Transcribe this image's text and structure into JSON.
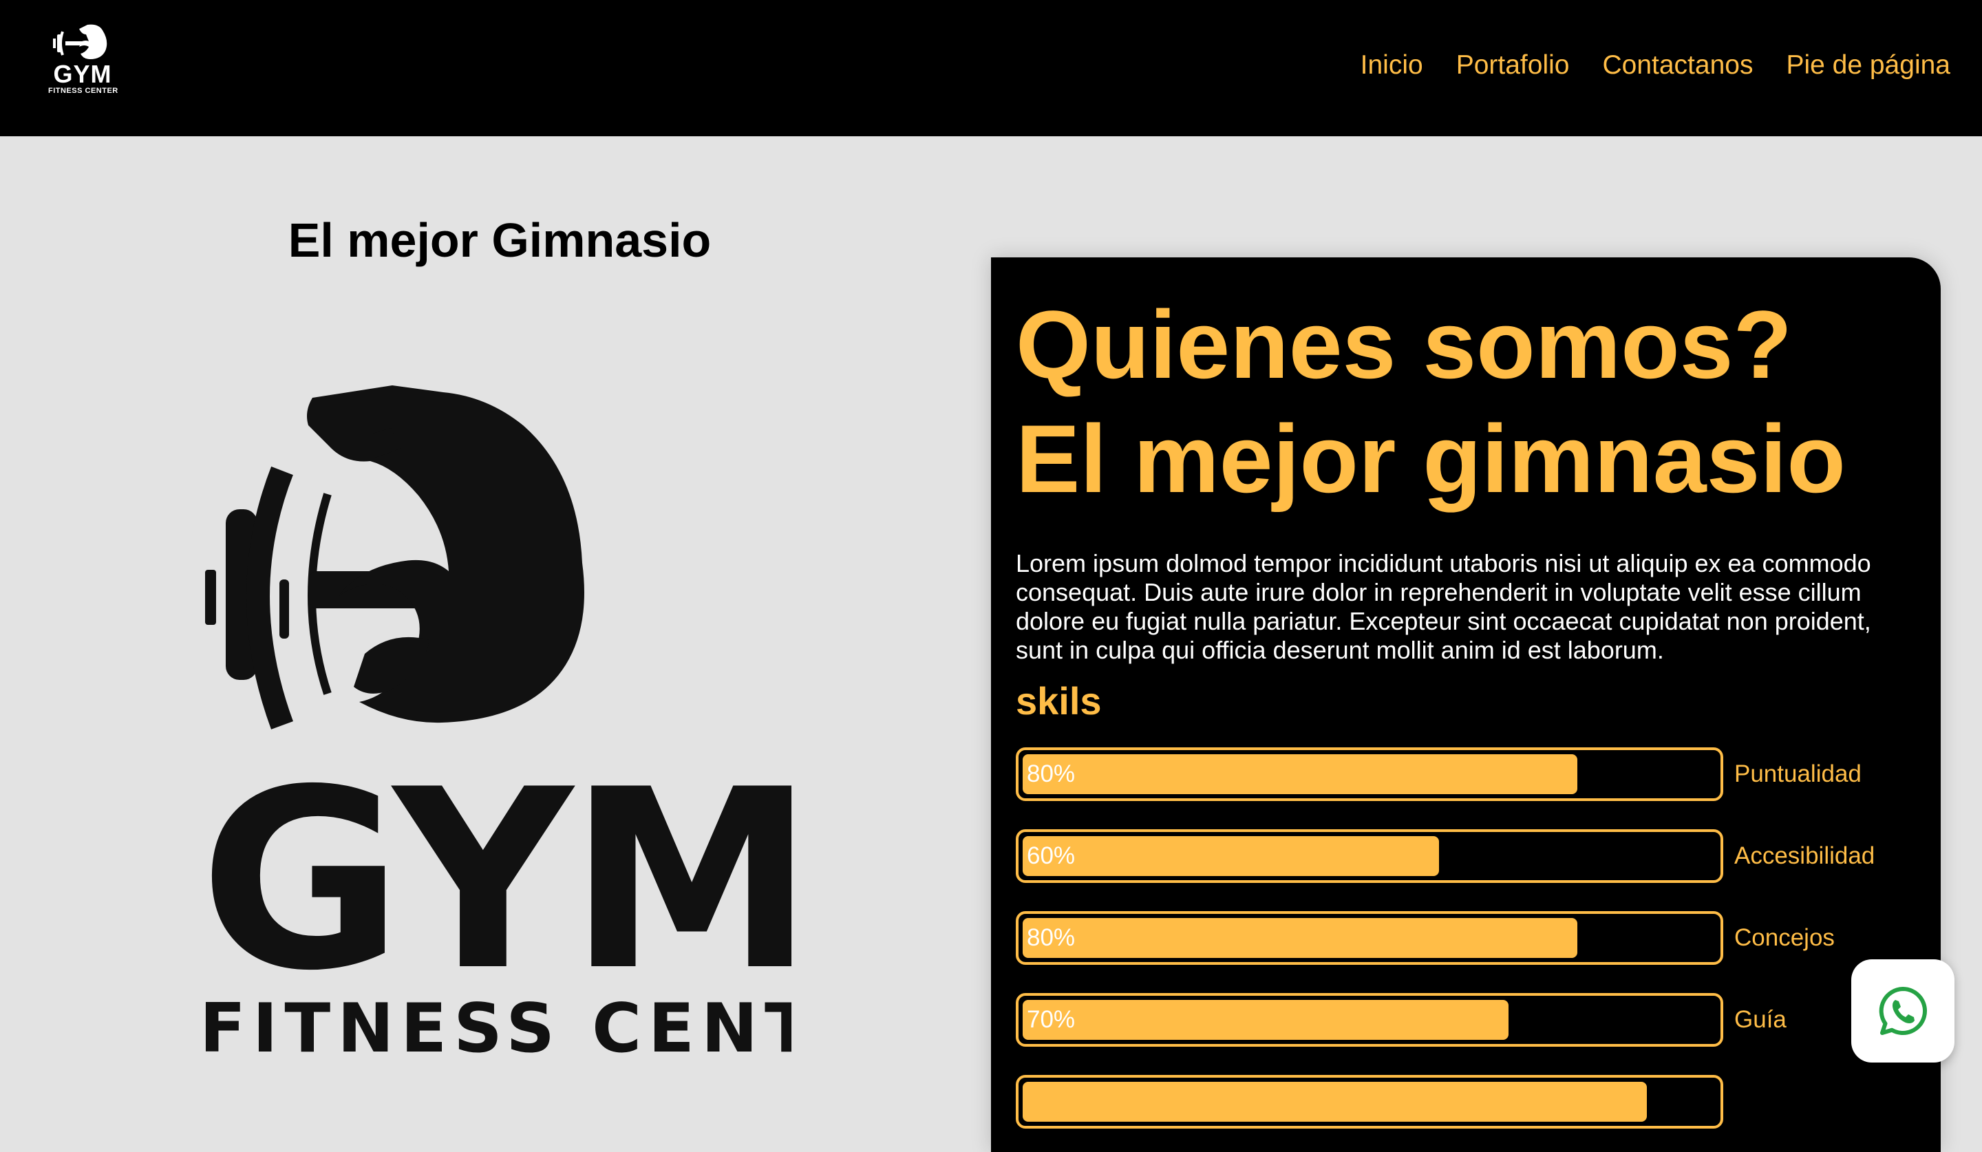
{
  "navbar": {
    "logo": {
      "word": "GYM",
      "sub": "FITNESS CENTER"
    },
    "links": [
      {
        "label": "Inicio"
      },
      {
        "label": "Portafolio"
      },
      {
        "label": "Contactanos"
      },
      {
        "label": "Pie de página"
      }
    ]
  },
  "hero": {
    "title": "El mejor Gimnasio",
    "logo": {
      "word": "GYM",
      "sub": "FITNESS CENTER",
      "icon": "dumbbell-arm-icon"
    }
  },
  "about": {
    "heading_line1": "Quienes somos?",
    "heading_line2": "El mejor gimnasio",
    "text": "Lorem ipsum dolmod tempor incididunt utaboris nisi ut aliquip ex ea commodo consequat. Duis aute irure dolor in reprehenderit in voluptate velit esse cillum dolore eu fugiat nulla pariatur. Excepteur sint occaecat cupidatat non proident, sunt in culpa qui officia deserunt mollit anim id est laborum.",
    "skills_title": "skils",
    "skills": [
      {
        "label": "Puntualidad",
        "percent_text": "80%",
        "value": 80
      },
      {
        "label": "Accesibilidad",
        "percent_text": "60%",
        "value": 60
      },
      {
        "label": "Concejos",
        "percent_text": "80%",
        "value": 80
      },
      {
        "label": "Guía",
        "percent_text": "70%",
        "value": 70
      },
      {
        "label": "",
        "percent_text": "",
        "value": 90
      }
    ]
  },
  "whatsapp": {
    "icon": "whatsapp-icon"
  },
  "colors": {
    "accent": "#ffbd47",
    "background": "#e3e3e3",
    "dark": "#000000"
  }
}
